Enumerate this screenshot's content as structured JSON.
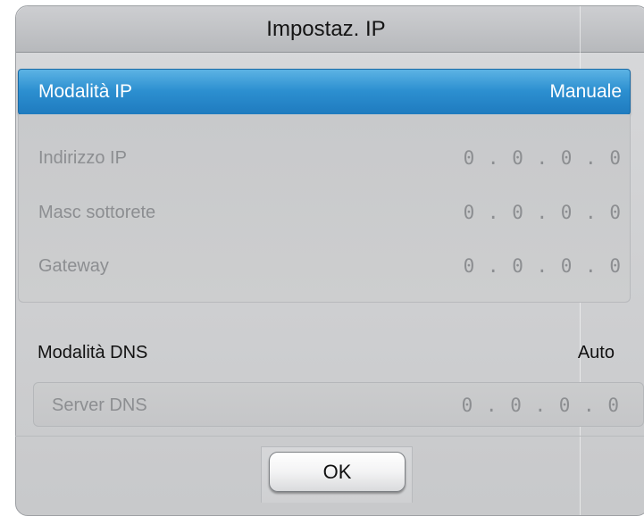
{
  "dialog": {
    "title": "Impostaz. IP"
  },
  "ip_mode": {
    "label": "Modalità IP",
    "value": "Manuale"
  },
  "ip_fields": [
    {
      "label": "Indirizzo IP",
      "value": "0 . 0 . 0 . 0"
    },
    {
      "label": "Masc sottorete",
      "value": "0 . 0 . 0 . 0"
    },
    {
      "label": "Gateway",
      "value": "0 . 0 . 0 . 0"
    }
  ],
  "dns_mode": {
    "label": "Modalità DNS",
    "value": "Auto"
  },
  "dns_server": {
    "label": "Server DNS",
    "value": "0 . 0 . 0 . 0"
  },
  "buttons": {
    "ok_label": "OK"
  },
  "colors": {
    "selection_blue": "#2c8fd0",
    "disabled_text": "#8c8e91",
    "panel_gray": "#cfd0d2"
  }
}
